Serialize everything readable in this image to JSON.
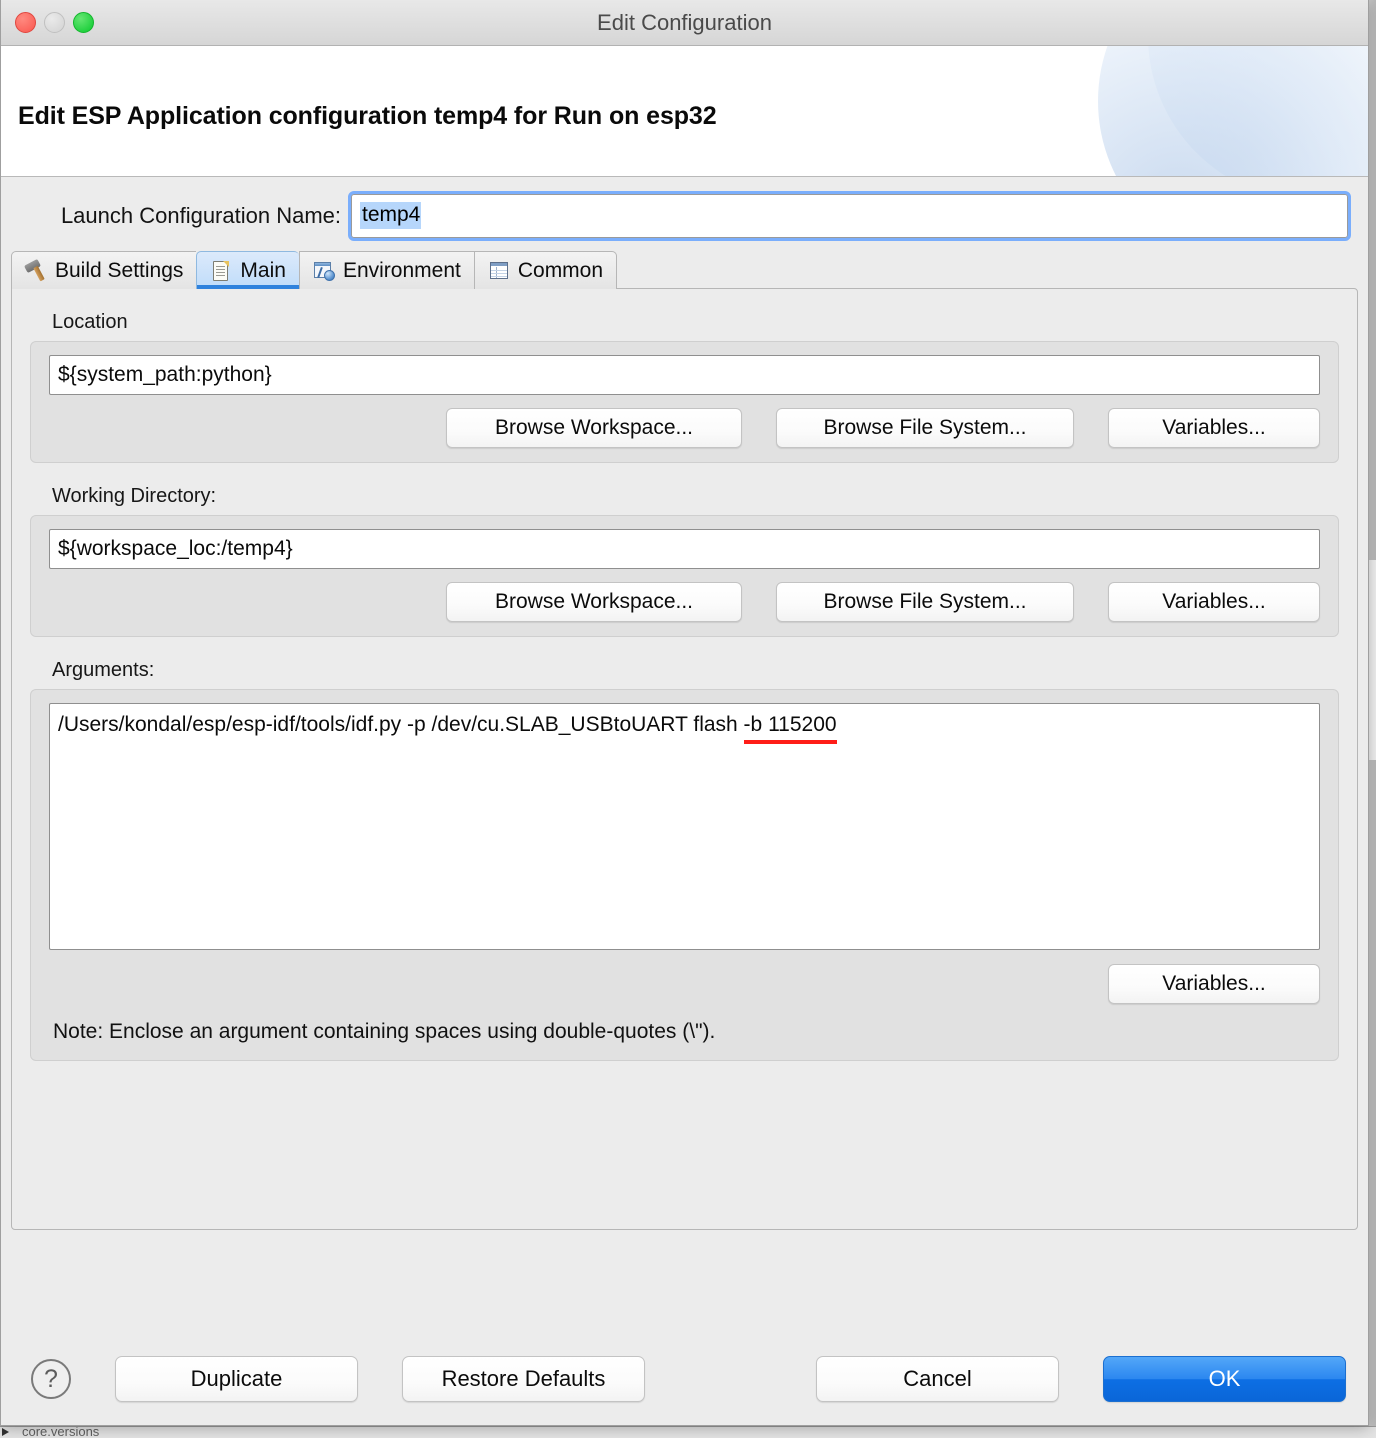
{
  "window": {
    "title": "Edit Configuration",
    "traffic_lights": [
      "close-button",
      "minimize-button",
      "maximize-button"
    ]
  },
  "banner": {
    "heading": "Edit ESP Application configuration temp4 for Run on esp32"
  },
  "launch_name": {
    "label": "Launch Configuration Name:",
    "value": "temp4"
  },
  "tabs": [
    {
      "label": "Build Settings",
      "icon": "hammer-icon",
      "selected": false
    },
    {
      "label": "Main",
      "icon": "document-icon",
      "selected": true
    },
    {
      "label": "Environment",
      "icon": "environment-icon",
      "selected": false
    },
    {
      "label": "Common",
      "icon": "table-icon",
      "selected": false
    }
  ],
  "location": {
    "label": "Location",
    "value": "${system_path:python}",
    "buttons": {
      "browse_workspace": "Browse Workspace...",
      "browse_file_system": "Browse File System...",
      "variables": "Variables..."
    }
  },
  "working_directory": {
    "label": "Working Directory:",
    "value": "${workspace_loc:/temp4}",
    "buttons": {
      "browse_workspace": "Browse Workspace...",
      "browse_file_system": "Browse File System...",
      "variables": "Variables..."
    }
  },
  "arguments": {
    "label": "Arguments:",
    "value": "/Users/kondal/esp/esp-idf/tools/idf.py -p /dev/cu.SLAB_USBtoUART flash -b 115200",
    "highlighted_fragment": "-b 115200",
    "highlight_color": "#ff1d18",
    "variables_button": "Variables...",
    "note": "Note: Enclose an argument containing spaces using double-quotes (\\\")."
  },
  "footer": {
    "help": "?",
    "duplicate": "Duplicate",
    "restore_defaults": "Restore Defaults",
    "cancel": "Cancel",
    "ok": "OK",
    "primary_color": "#0d6fe4"
  },
  "background": {
    "clipped_text": "core.versions"
  }
}
